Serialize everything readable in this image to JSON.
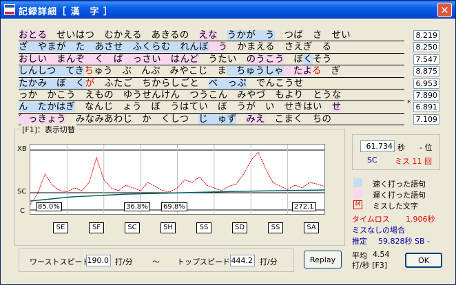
{
  "window": {
    "title": "記録詳細［ 漢　字 ］",
    "close": "✕"
  },
  "lines": [
    [
      [
        "おとる",
        "slow"
      ],
      [
        "　せいはつ　むかえる　あきるの　",
        ""
      ],
      [
        "えな",
        "slow"
      ],
      [
        "　",
        ""
      ],
      [
        "うかが　う",
        "fast"
      ],
      [
        "　つば　さ　せい",
        ""
      ]
    ],
    [
      [
        "ざ　やまが　た　あさせ　ふくらむ　れんぼ",
        "fast"
      ],
      [
        "　う",
        "slow"
      ],
      [
        "　かまえる　さえぎ　る",
        ""
      ]
    ],
    [
      [
        "おしい　まんぞ　く　ば　っさい　はんど",
        "slow"
      ],
      [
        "　うたい　",
        ""
      ],
      [
        "のうこう",
        "slow"
      ],
      [
        "　ぼ",
        ""
      ],
      [
        "く",
        "fast"
      ],
      [
        "そう",
        ""
      ]
    ],
    [
      [
        "しんしつ　てき",
        "fast"
      ],
      [
        "ち",
        "miss"
      ],
      [
        "ゅう　ぶ　んぷ　みやこじ　ま",
        ""
      ],
      [
        "　ちゅうしゃ",
        "fast"
      ],
      [
        "　たよ",
        "slow"
      ],
      [
        "る",
        "miss"
      ],
      [
        "　ぎ",
        ""
      ]
    ],
    [
      [
        "たかみ　ぼ　く",
        "fast"
      ],
      [
        "が",
        "miss"
      ],
      [
        "　ふたご　ちからしごと　",
        ""
      ],
      [
        "べ　っぷ",
        "fast"
      ],
      [
        "　でんこうせ",
        ""
      ]
    ],
    [
      [
        "っか　かこう　えもの　ゆうせんけん　つうこん　みやづ　もより　とうな",
        ""
      ]
    ],
    [
      [
        "ん　たかはぎ",
        "fast"
      ],
      [
        "　なんじ　ょう　ぼ　うはてい　ぼ　うが　い　せきはい　",
        ""
      ],
      [
        "せ",
        "slow"
      ]
    ],
    [
      [
        "゛っきょう",
        "slow"
      ],
      [
        "　みなみあわじ　か　くしつ　",
        ""
      ],
      [
        "じ　ゅず",
        "fast"
      ],
      [
        "　",
        ""
      ],
      [
        "みえ",
        "slow"
      ],
      [
        "　こまく　ちの",
        ""
      ]
    ]
  ],
  "times": [
    "8.219",
    "8.250",
    "7.547",
    "8.875",
    "6.953",
    "7.890",
    "6.891",
    "7.109"
  ],
  "star": "*",
  "group_label": "[F1]：表示切替",
  "chart_data": {
    "type": "line",
    "y_levels": [
      "XB",
      "SC",
      "C"
    ],
    "sections": [
      "SE",
      "SF",
      "SC",
      "SH",
      "SS",
      "SD",
      "SS",
      "SA"
    ],
    "percent_labels": [
      "85.0%",
      "36.8%",
      "69.8%",
      "272.1"
    ],
    "speed_series": [
      0.05,
      0.25,
      0.6,
      0.4,
      0.3,
      0.28,
      0.35,
      0.3,
      0.45,
      0.9,
      0.5,
      0.35,
      0.3,
      0.4,
      0.35,
      0.3,
      0.45,
      0.38,
      0.3,
      0.28,
      0.35,
      0.5,
      0.45,
      0.55,
      0.4,
      0.35,
      0.3,
      0.38,
      0.42,
      0.6,
      0.85,
      1.0,
      0.7,
      0.45,
      0.38,
      0.32,
      0.4,
      0.35,
      0.45,
      0.42,
      0.38
    ]
  },
  "result": {
    "time": "61.734",
    "sec_unit": "秒",
    "rank": "- 位",
    "sc": "SC",
    "miss": "ミス 11 回"
  },
  "legend": {
    "fast": "速く打った語句",
    "slow": "遅く打った語句",
    "miss_mark": "M",
    "miss": "ミスした文字"
  },
  "timeloss_label": "タイムロス",
  "timeloss_value": "1.906秒",
  "nomiss_label": "ミスなしの場合",
  "estimate_label": "推定",
  "estimate_value": "59.828秒 SB -",
  "avg_label": "平均",
  "avg_value": "4.54",
  "avg_unit": "打/秒 [F3]",
  "worst_label": "ワーストスピード",
  "worst_value": "190.0",
  "unit": "打/分",
  "tilde": "〜",
  "top_label": "トップスピード",
  "top_value": "444.2",
  "replay": "Replay",
  "ok": "OK"
}
